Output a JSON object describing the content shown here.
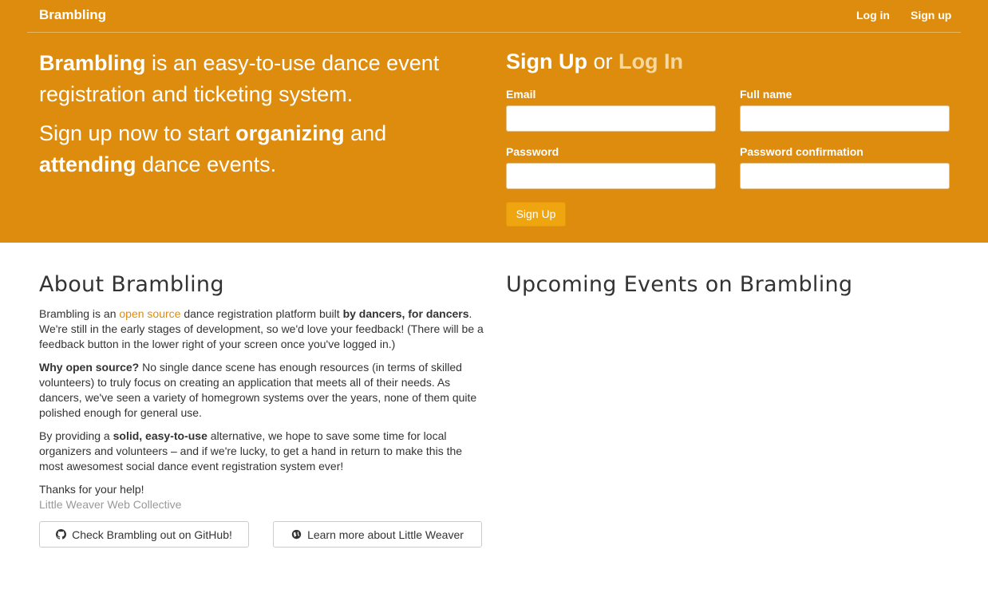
{
  "nav": {
    "brand": "Brambling",
    "login": "Log in",
    "signup": "Sign up"
  },
  "hero": {
    "line1_bold": "Brambling",
    "line1_rest": " is an easy-to-use dance event registration and ticketing system.",
    "line2_a": "Sign up now to start ",
    "line2_bold1": "organizing",
    "line2_b": " and ",
    "line2_bold2": "attending",
    "line2_c": " dance events."
  },
  "signup": {
    "title_signup": "Sign Up",
    "title_or": " or ",
    "title_login": "Log In",
    "email_label": "Email",
    "fullname_label": "Full name",
    "password_label": "Password",
    "password_confirm_label": "Password confirmation",
    "email_value": "",
    "fullname_value": "",
    "password_value": "",
    "password_confirm_value": "",
    "button": "Sign Up"
  },
  "about": {
    "heading": "About Brambling",
    "p1_a": "Brambling is an ",
    "p1_link": "open source",
    "p1_b": " dance registration platform built ",
    "p1_bold": "by dancers, for dancers",
    "p1_c": ". We're still in the early stages of development, so we'd love your feedback! (There will be a feedback button in the lower right of your screen once you've logged in.)",
    "p2_bold": "Why open source?",
    "p2_rest": " No single dance scene has enough resources (in terms of skilled volunteers) to truly focus on creating an application that meets all of their needs. As dancers, we've seen a variety of homegrown systems over the years, none of them quite polished enough for general use.",
    "p3_a": "By providing a ",
    "p3_bold": "solid, easy-to-use",
    "p3_b": " alternative, we hope to save some time for local organizers and volunteers – and if we're lucky, to get a hand in return to make this the most awesomest social dance event registration system ever!",
    "thanks": "Thanks for your help!",
    "signature": "Little Weaver Web Collective",
    "github_button": "Check Brambling out on GitHub!",
    "weaver_button": "Learn more about Little Weaver"
  },
  "upcoming": {
    "heading": "Upcoming Events on Brambling"
  },
  "colors": {
    "hero_bg": "#de8c0e",
    "signup_button": "#efa510",
    "link": "#de8c0e"
  },
  "icons": {
    "email_field": "contact-card-icon",
    "password_field": "key-icon",
    "github": "github-icon",
    "weaver": "globe-icon"
  }
}
